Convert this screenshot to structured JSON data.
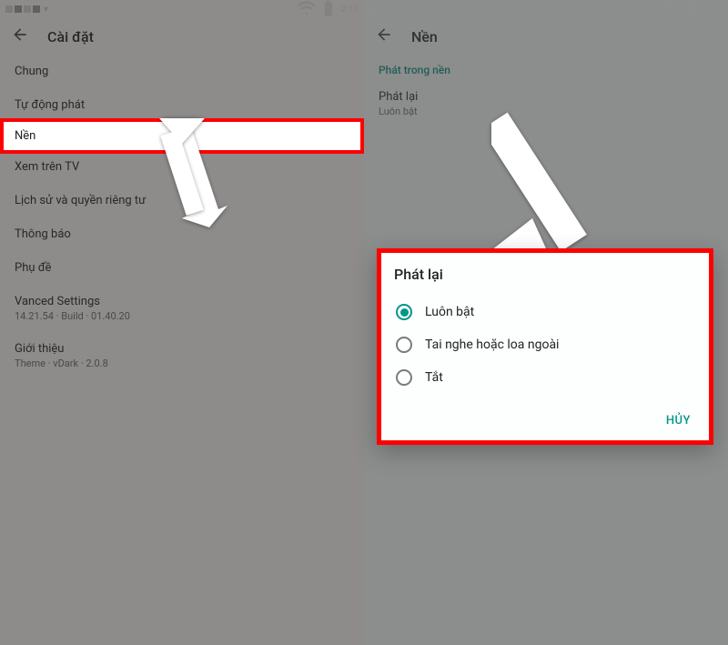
{
  "status": {
    "time": "2:15"
  },
  "left": {
    "title": "Cài đặt",
    "items": [
      {
        "label": "Chung"
      },
      {
        "label": "Tự động phát"
      },
      {
        "label": "Nền",
        "highlight": true
      },
      {
        "label": "Xem trên TV"
      },
      {
        "label": "Lịch sử và quyền riêng tư"
      },
      {
        "label": "Thông báo"
      },
      {
        "label": "Phụ đề"
      },
      {
        "label": "Vanced Settings",
        "sub": "14.21.54 · Build · 01.40.20"
      },
      {
        "label": "Giới thiệu",
        "sub": "Theme · vDark · 2.0.8"
      }
    ]
  },
  "right": {
    "title": "Nền",
    "section": "Phát trong nền",
    "item": {
      "label": "Phát lại",
      "sub": "Luôn bật"
    }
  },
  "dialog": {
    "title": "Phát lại",
    "options": [
      {
        "label": "Luôn bật",
        "selected": true
      },
      {
        "label": "Tai nghe hoặc loa ngoài",
        "selected": false
      },
      {
        "label": "Tắt",
        "selected": false
      }
    ],
    "cancel": "HỦY"
  }
}
